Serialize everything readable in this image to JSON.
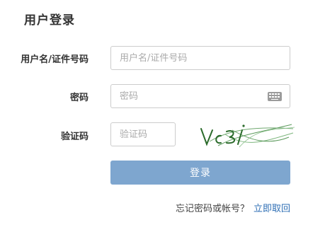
{
  "title": "用户登录",
  "username": {
    "label": "用户名/证件号码",
    "placeholder": "用户名/证件号码"
  },
  "password": {
    "label": "密码",
    "placeholder": "密码",
    "keyboard_icon": "keyboard-icon"
  },
  "captcha": {
    "label": "验证码",
    "placeholder": "验证码"
  },
  "login_button": "登录",
  "forgot": {
    "question": "忘记密码或帐号？",
    "link": "立即取回"
  },
  "colors": {
    "button": "#7ea6cf",
    "link": "#2f6fb5",
    "captcha_text": "#2b6b2b"
  }
}
